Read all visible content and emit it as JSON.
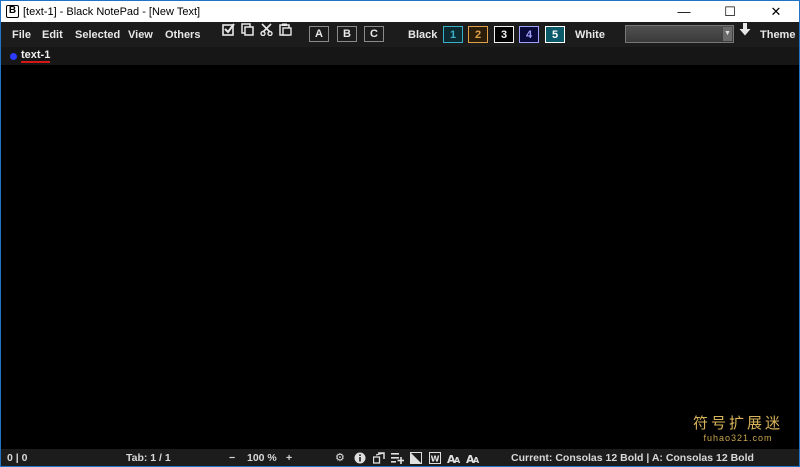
{
  "title": {
    "app_logo": "B",
    "text": "[text-1] - Black NotePad - [New Text]",
    "minimize": "—",
    "maximize": "☐",
    "close": "✕"
  },
  "menu": {
    "file": "File",
    "edit": "Edit",
    "selected": "Selected",
    "view": "View",
    "others": "Others"
  },
  "toolbar": {
    "icons": [
      "checkbox-icon",
      "copy-icon",
      "cut-icon",
      "paste-icon"
    ],
    "abc": [
      "A",
      "B",
      "C"
    ],
    "black_label": "Black",
    "numbers": [
      {
        "label": "1",
        "color": "#3ab0c8",
        "bg": "#0d2a30"
      },
      {
        "label": "2",
        "color": "#e0a04a",
        "bg": "#2a1d0a"
      },
      {
        "label": "3",
        "color": "#f0f0f0",
        "bg": "#000000"
      },
      {
        "label": "4",
        "color": "#a0a0ff",
        "bg": "#0a0a3a"
      },
      {
        "label": "5",
        "color": "#ffffff",
        "bg": "#0a5a6a"
      }
    ],
    "white_label": "White",
    "theme_value": "",
    "theme_label": "Theme"
  },
  "tabs": [
    {
      "label": "text-1",
      "dot_color": "#2b3bff"
    }
  ],
  "watermark": {
    "cn": "符号扩展迷",
    "url": "fuhao321.com"
  },
  "status": {
    "position": "0 | 0",
    "tab": "Tab: 1 / 1",
    "zoom_minus": "−",
    "zoom": "100 %",
    "zoom_plus": "+",
    "font_info": "Current: Consolas 12 Bold | A: Consolas 12 Bold"
  },
  "colors": {
    "accent": "#1e74c7",
    "toolbar_bg": "#1c1c1c",
    "editor_bg": "#000000",
    "tab_underline": "#d01818"
  }
}
